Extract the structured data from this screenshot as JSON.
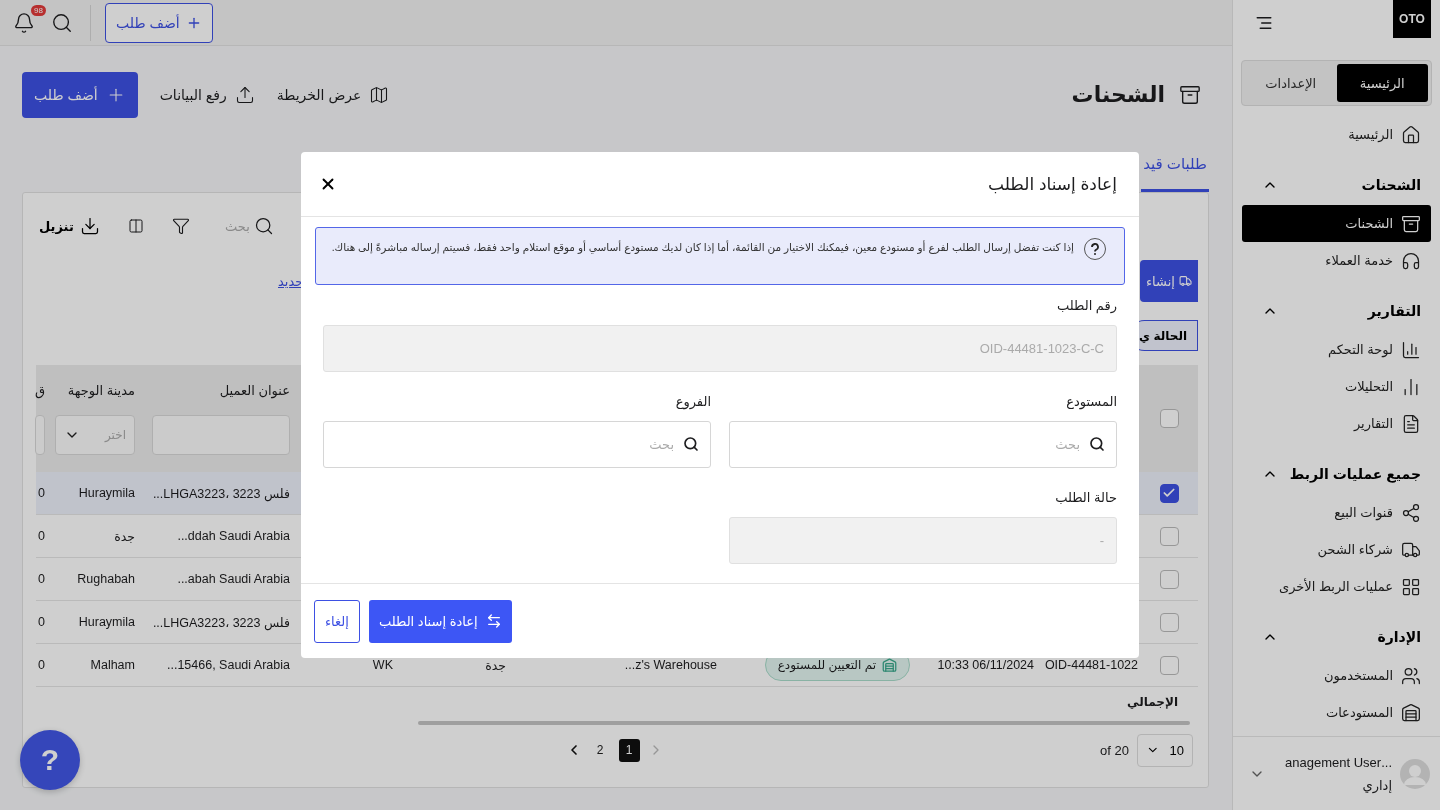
{
  "topbar": {
    "notification_count": "98",
    "add_button": "أضف طلب"
  },
  "help_button": "?",
  "page": {
    "title": "الشحنات",
    "actions": [
      {
        "kind": "map",
        "label": "عرض الخريطة"
      },
      {
        "kind": "upload",
        "label": "رفع البيانات"
      },
      {
        "kind": "primary",
        "label": "أضف طلب"
      }
    ]
  },
  "tabs": [
    {
      "label": "طلبات قيد",
      "selected": true
    }
  ],
  "toolbar": {
    "search_placeholder": "بحث",
    "download": "تنزيل"
  },
  "create_button": "إنشاء",
  "select_link": "حديد",
  "status_chip": "الحالة ي",
  "table": {
    "header_checked": false,
    "columns": {
      "address": "عنوان العميل",
      "city": "مدينة الوجهة",
      "column_9": "ق"
    },
    "city_filter_placeholder": "اختر",
    "rows": [
      {
        "checked": true,
        "selected": true,
        "address": "...LHGA3223، 3223 فلس",
        "city": "Huraymila",
        "column_9": "0"
      },
      {
        "checked": false,
        "selected": false,
        "address": "...ddah Saudi Arabia",
        "city": "جدة",
        "column_9": "0"
      },
      {
        "checked": false,
        "selected": false,
        "address": "...abah Saudi Arabia",
        "city": "Rughabah",
        "column_9": "0"
      },
      {
        "checked": false,
        "selected": false,
        "address": "...LHGA3223، 3223 فلس",
        "city": "Huraymila",
        "column_9": "0"
      },
      {
        "checked": false,
        "selected": false,
        "order_id": "OID-44481-1022",
        "date": "10:33 06/11/2024",
        "status": "تم التعيين للمستودع",
        "warehouse": "...z's Warehouse",
        "column_5": "جدة",
        "column_6": "WK",
        "address": "...15466, Saudi Arabia",
        "city": "Malham",
        "column_9": "0"
      }
    ],
    "total_label": "الإجمالي"
  },
  "pagination": {
    "prev_disabled": true,
    "next_disabled": false,
    "pages": [
      {
        "label": "1",
        "selected": true
      },
      {
        "label": "2",
        "selected": false
      }
    ],
    "total": "20 of",
    "page_size": "10"
  },
  "sidebar": {
    "logo": "OTO",
    "tabs": [
      {
        "label": "الرئيسية",
        "selected": true
      },
      {
        "label": "الإعدادات",
        "selected": false
      }
    ],
    "nav": [
      {
        "kind": "link",
        "label": "الرئيسية",
        "selected": false
      },
      {
        "kind": "section",
        "label": "الشحنات",
        "expanded": true,
        "children": [
          {
            "label": "الشحنات",
            "selected": true
          },
          {
            "label": "خدمة العملاء",
            "selected": false
          }
        ]
      },
      {
        "kind": "section",
        "label": "التقارير",
        "expanded": true,
        "children": [
          {
            "label": "لوحة التحكم",
            "selected": false
          },
          {
            "label": "التحليلات",
            "selected": false
          },
          {
            "label": "التقارير",
            "selected": false
          }
        ]
      },
      {
        "kind": "section",
        "label": "جميع عمليات الربط",
        "expanded": true,
        "children": [
          {
            "label": "قنوات البيع",
            "selected": false
          },
          {
            "label": "شركاء الشحن",
            "selected": false
          },
          {
            "label": "عمليات الربط الأخرى",
            "selected": false
          }
        ]
      },
      {
        "kind": "section",
        "label": "الإدارة",
        "expanded": true,
        "children": [
          {
            "label": "المستخدمون",
            "selected": false
          },
          {
            "label": "المستودعات",
            "selected": false
          }
        ]
      }
    ],
    "user": {
      "name": "...anagement User",
      "role": "إداري"
    }
  },
  "modal": {
    "title": "إعادة إسناد الطلب",
    "info": "إذا كنت تفضل إرسال الطلب لفرع أو مستودع معين، فيمكنك الاختيار من القائمة، أما إذا كان لديك مستودع أساسي أو موقع استلام واحد فقط، فسيتم إرساله مباشرةً إلى هناك.",
    "fields": [
      {
        "kind": "readonly",
        "label": "رقم الطلب",
        "value": "OID-44481-1023-C-C"
      },
      {
        "kind": "search",
        "label": "المستودع",
        "placeholder": "بحث"
      },
      {
        "kind": "search",
        "label": "الفروع",
        "placeholder": "بحث"
      },
      {
        "kind": "readonly",
        "label": "حالة الطلب",
        "value": "-"
      }
    ],
    "buttons": [
      {
        "kind": "primary",
        "label": "إعادة إسناد الطلب"
      },
      {
        "kind": "secondary",
        "label": "إلغاء"
      }
    ]
  }
}
